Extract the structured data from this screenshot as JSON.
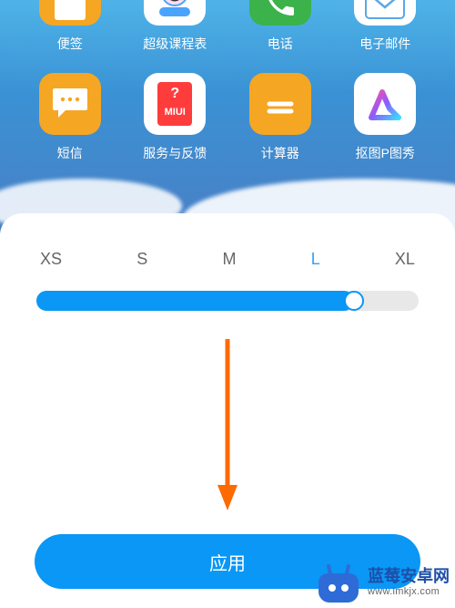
{
  "apps_row1": [
    {
      "name": "notes",
      "label": "便签",
      "icon": "notes-icon"
    },
    {
      "name": "class",
      "label": "超级课程表",
      "icon": "class-schedule-icon"
    },
    {
      "name": "phone",
      "label": "电话",
      "icon": "phone-icon"
    },
    {
      "name": "mail",
      "label": "电子邮件",
      "icon": "mail-icon"
    }
  ],
  "apps_row2": [
    {
      "name": "sms",
      "label": "短信",
      "icon": "sms-icon"
    },
    {
      "name": "feedback",
      "label": "服务与反馈",
      "icon": "miui-feedback-icon",
      "tag_text": "MIUI"
    },
    {
      "name": "calc",
      "label": "计算器",
      "icon": "calculator-icon"
    },
    {
      "name": "koutu",
      "label": "抠图P图秀",
      "icon": "koutu-icon"
    }
  ],
  "size_panel": {
    "options": [
      "XS",
      "S",
      "M",
      "L",
      "XL"
    ],
    "selected_index": 3,
    "slider_fill_percent": 83
  },
  "apply_button_label": "应用",
  "colors": {
    "accent": "#0a97f5",
    "app_orange": "#f5a623",
    "app_green": "#3bb24a",
    "annotation_arrow": "#ff6a00"
  },
  "watermark": {
    "title": "蓝莓安卓网",
    "url": "www.lmkjx.com"
  }
}
